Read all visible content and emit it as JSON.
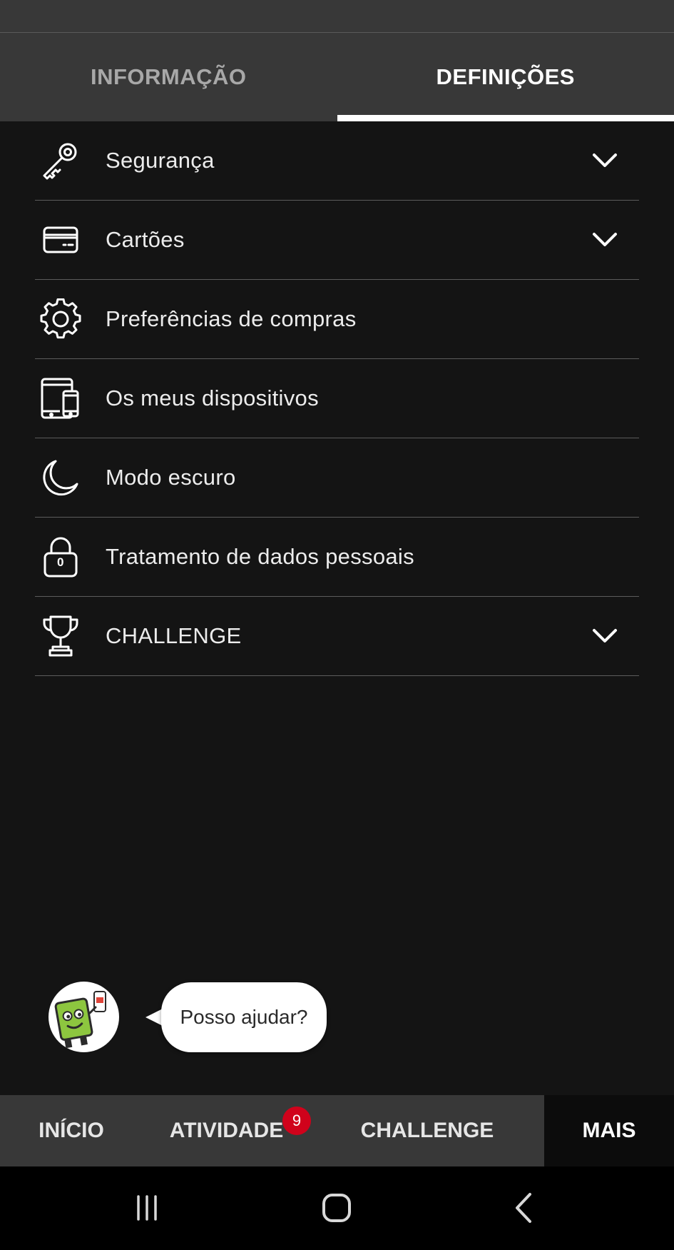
{
  "top_tabs": [
    {
      "label": "INFORMAÇÃO",
      "active": false
    },
    {
      "label": "DEFINIÇÕES",
      "active": true
    }
  ],
  "settings": [
    {
      "label": "Segurança",
      "icon": "key-icon",
      "expandable": true
    },
    {
      "label": "Cartões",
      "icon": "card-icon",
      "expandable": true
    },
    {
      "label": "Preferências de compras",
      "icon": "gear-icon",
      "expandable": false
    },
    {
      "label": "Os meus dispositivos",
      "icon": "devices-icon",
      "expandable": false
    },
    {
      "label": "Modo escuro",
      "icon": "moon-icon",
      "expandable": false
    },
    {
      "label": "Tratamento de dados pessoais",
      "icon": "lock-icon",
      "expandable": false
    },
    {
      "label": "CHALLENGE",
      "icon": "trophy-icon",
      "expandable": true
    }
  ],
  "lock_icon_digit": "0",
  "chat": {
    "bubble_text": "Posso ajudar?"
  },
  "bottom_nav": {
    "items": [
      {
        "label": "INÍCIO",
        "active": false
      },
      {
        "label": "ATIVIDADE",
        "active": false
      },
      {
        "label": "CHALLENGE",
        "active": false
      },
      {
        "label": "MAIS",
        "active": true
      }
    ],
    "activity_badge": "9"
  },
  "colors": {
    "background": "#141414",
    "tab_bar": "#383838",
    "badge": "#d0021b",
    "avatar_green": "#8dc63f"
  }
}
